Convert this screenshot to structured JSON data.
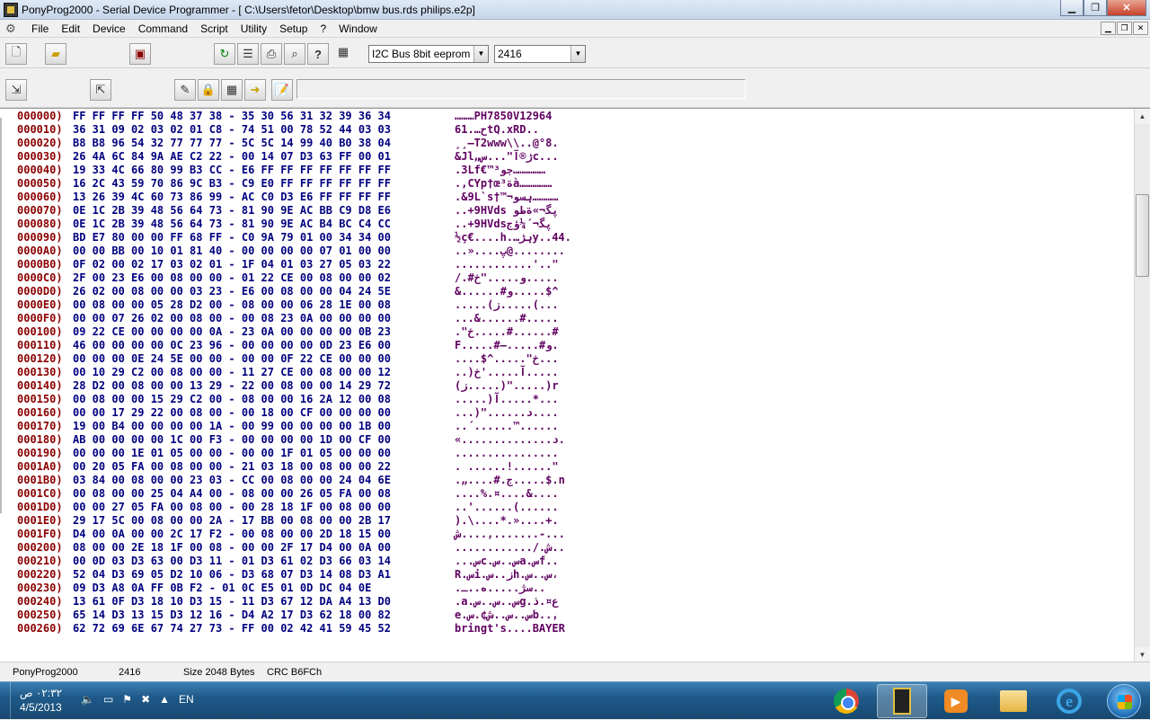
{
  "window": {
    "title": "PonyProg2000 - Serial Device Programmer - [ C:\\Users\\fetor\\Desktop\\bmw bus.rds philips.e2p]"
  },
  "menu": [
    "File",
    "Edit",
    "Device",
    "Command",
    "Script",
    "Utility",
    "Setup",
    "?",
    "Window"
  ],
  "toolbar": {
    "device_family": "I2C Bus 8bit eeprom",
    "device_type": "2416"
  },
  "editor": {
    "rows": [
      {
        "addr": "000000)",
        "hex": "FF FF FF FF 50 48 37 38 - 35 30 56 31 32 39 36 34",
        "ascii": "………PH7850V12964"
      },
      {
        "addr": "000010)",
        "hex": "36 31 09 02 03 02 01 C8 - 74 51 00 78 52 44 03 03",
        "ascii": "61.…حtQ.xRD.."
      },
      {
        "addr": "000020)",
        "hex": "B8 B8 96 54 32 77 77 77 - 5C 5C 14 99 40 B0 38 04",
        "ascii": "¸¸–T2www\\\\..@°8."
      },
      {
        "addr": "000030)",
        "hex": "26 4A 6C 84 9A AE C2 22 - 00 14 07 D3 63 FF 00 01",
        "ascii": "&Jl„ڑ®آ\"...سc..."
      },
      {
        "addr": "000040)",
        "hex": "19 33 4C 66 80 99 B3 CC - E6 FF FF FF FF FF FF FF",
        "ascii": ".3Lf€™³جو……………"
      },
      {
        "addr": "000050)",
        "hex": "16 2C 43 59 70 86 9C B3 - C9 E0 FF FF FF FF FF FF",
        "ascii": ".,CYp†œ³ةà……………"
      },
      {
        "addr": "000060)",
        "hex": "13 26 39 4C 60 73 86 99 - AC C0 D3 E6 FF FF FF FF",
        "ascii": ".&9L`s†™¬ہسو…………"
      },
      {
        "addr": "000070)",
        "hex": "0E 1C 2B 39 48 56 64 73 - 81 90 9E AC BB C9 D8 E6",
        "ascii": "..+9HVds پگ‍¬»ةطو"
      },
      {
        "addr": "000080)",
        "hex": "0E 1C 2B 39 48 56 64 73 - 81 90 9E AC B4 BC C4 CC",
        "ascii": "..+9HVdsپگ‍¬´¼ؤج"
      },
      {
        "addr": "000090)",
        "hex": "BD E7 80 00 00 FF 68 FF - C0 9A 79 01 00 34 34 00",
        "ascii": "½ç€....h.…ہڑy..44."
      },
      {
        "addr": "0000A0)",
        "hex": "00 00 BB 00 10 01 81 40 - 00 00 00 00 07 01 00 00",
        "ascii": "..»....پ@........"
      },
      {
        "addr": "0000B0)",
        "hex": "0F 02 00 02 17 03 02 01 - 1F 04 01 03 27 05 03 22",
        "ascii": "............'..\""
      },
      {
        "addr": "0000C0)",
        "hex": "2F 00 23 E6 00 08 00 00 - 01 22 CE 00 08 00 00 02",
        "ascii": "/.#و.....\"خ....."
      },
      {
        "addr": "0000D0)",
        "hex": "26 02 00 08 00 00 03 23 - E6 00 08 00 00 04 24 5E",
        "ascii": "&......#و.....$^"
      },
      {
        "addr": "0000E0)",
        "hex": "00 08 00 00 05 28 D2 00 - 08 00 00 06 28 1E 00 08",
        "ascii": ".....(ز.....(..."
      },
      {
        "addr": "0000F0)",
        "hex": "00 00 07 26 02 00 08 00 - 00 08 23 0A 00 00 00 00",
        "ascii": "...&......#....."
      },
      {
        "addr": "000100)",
        "hex": "09 22 CE 00 00 00 00 0A - 23 0A 00 00 00 00 0B 23",
        "ascii": ".\"خ.....#......#"
      },
      {
        "addr": "000110)",
        "hex": "46 00 00 00 00 0C 23 96 - 00 00 00 00 0D 23 E6 00",
        "ascii": "F.....#–.....#و."
      },
      {
        "addr": "000120)",
        "hex": "00 00 00 0E 24 5E 00 00 - 00 00 0F 22 CE 00 00 00",
        "ascii": "....$^.....\"خ..."
      },
      {
        "addr": "000130)",
        "hex": "00 10 29 C2 00 08 00 00 - 11 27 CE 00 08 00 00 12",
        "ascii": "..)آ.....'خ....."
      },
      {
        "addr": "000140)",
        "hex": "28 D2 00 08 00 00 13 29 - 22 00 08 00 00 14 29 72",
        "ascii": "(ز.....)\".....)r"
      },
      {
        "addr": "000150)",
        "hex": "00 08 00 00 15 29 C2 00 - 08 00 00 16 2A 12 00 08",
        "ascii": ".....)آ.....*..."
      },
      {
        "addr": "000160)",
        "hex": "00 00 17 29 22 00 08 00 - 00 18 00 CF 00 00 00 00",
        "ascii": "...)\"......د...."
      },
      {
        "addr": "000170)",
        "hex": "19 00 B4 00 00 00 00 1A - 00 99 00 00 00 00 1B 00",
        "ascii": "..´......™......"
      },
      {
        "addr": "000180)",
        "hex": "AB 00 00 00 00 1C 00 F3 - 00 00 00 00 1D 00 CF 00",
        "ascii": "«..............د."
      },
      {
        "addr": "000190)",
        "hex": "00 00 00 1E 01 05 00 00 - 00 00 1F 01 05 00 00 00",
        "ascii": "................"
      },
      {
        "addr": "0001A0)",
        "hex": "00 20 05 FA 00 08 00 00 - 21 03 18 00 08 00 00 22",
        "ascii": ". ......!......\""
      },
      {
        "addr": "0001B0)",
        "hex": "03 84 00 08 00 00 23 03 - CC 00 08 00 00 24 04 6E",
        "ascii": ".„....#.ج.....$.n"
      },
      {
        "addr": "0001C0)",
        "hex": "00 08 00 00 25 04 A4 00 - 08 00 00 26 05 FA 00 08",
        "ascii": "....%.¤....&...."
      },
      {
        "addr": "0001D0)",
        "hex": "00 00 27 05 FA 00 08 00 - 00 28 18 1F 00 08 00 00",
        "ascii": "..'......(......"
      },
      {
        "addr": "0001E0)",
        "hex": "29 17 5C 00 08 00 00 2A - 17 BB 00 08 00 00 2B 17",
        "ascii": ").\\....*.»....+."
      },
      {
        "addr": "0001F0)",
        "hex": "D4 00 0A 00 00 2C 17 F2 - 00 08 00 00 2D 18 15 00",
        "ascii": "ش....,.......-..."
      },
      {
        "addr": "000200)",
        "hex": "08 00 00 2E 18 1F 00 08 - 00 00 2F 17 D4 00 0A 00",
        "ascii": "............/.ش.."
      },
      {
        "addr": "000210)",
        "hex": "00 0D 03 D3 63 00 D3 11 - 01 D3 61 02 D3 66 03 14",
        "ascii": "...سc.س..سa.سf.."
      },
      {
        "addr": "000220)",
        "hex": "52 04 D3 69 05 D2 10 06 - D3 68 07 D3 14 08 D3 A1",
        "ascii": "R.سi.ز..سh.س..س،"
      },
      {
        "addr": "000230)",
        "hex": "09 D3 A8 0A FF 0B F2 - 01 0C E5 01 0D DC 04 0E",
        "ascii": ".سژ.....ه..ـ.."
      },
      {
        "addr": "000240)",
        "hex": "13 61 0F D3 18 10 D3 15 - 11 D3 67 12 DA A4 13 D0",
        "ascii": ".a.س..س..سg.ع¤.ذ"
      },
      {
        "addr": "000250)",
        "hex": "65 14 D3 13 15 D3 12 16 - D4 A2 17 D3 62 18 00 82",
        "ascii": "e.س..س..ش¢.سb..‚"
      },
      {
        "addr": "000260)",
        "hex": "62 72 69 6E 67 74 27 73 - FF 00 02 42 41 59 45 52",
        "ascii": "bringt's....BAYER"
      }
    ]
  },
  "status": {
    "app": "PonyProg2000",
    "device": "2416",
    "size": "Size  2048 Bytes",
    "crc": "CRC  B6FCh"
  },
  "taskbar": {
    "time": "٠٢:٣٢ ص",
    "date": "4/5/2013",
    "lang": "EN"
  }
}
